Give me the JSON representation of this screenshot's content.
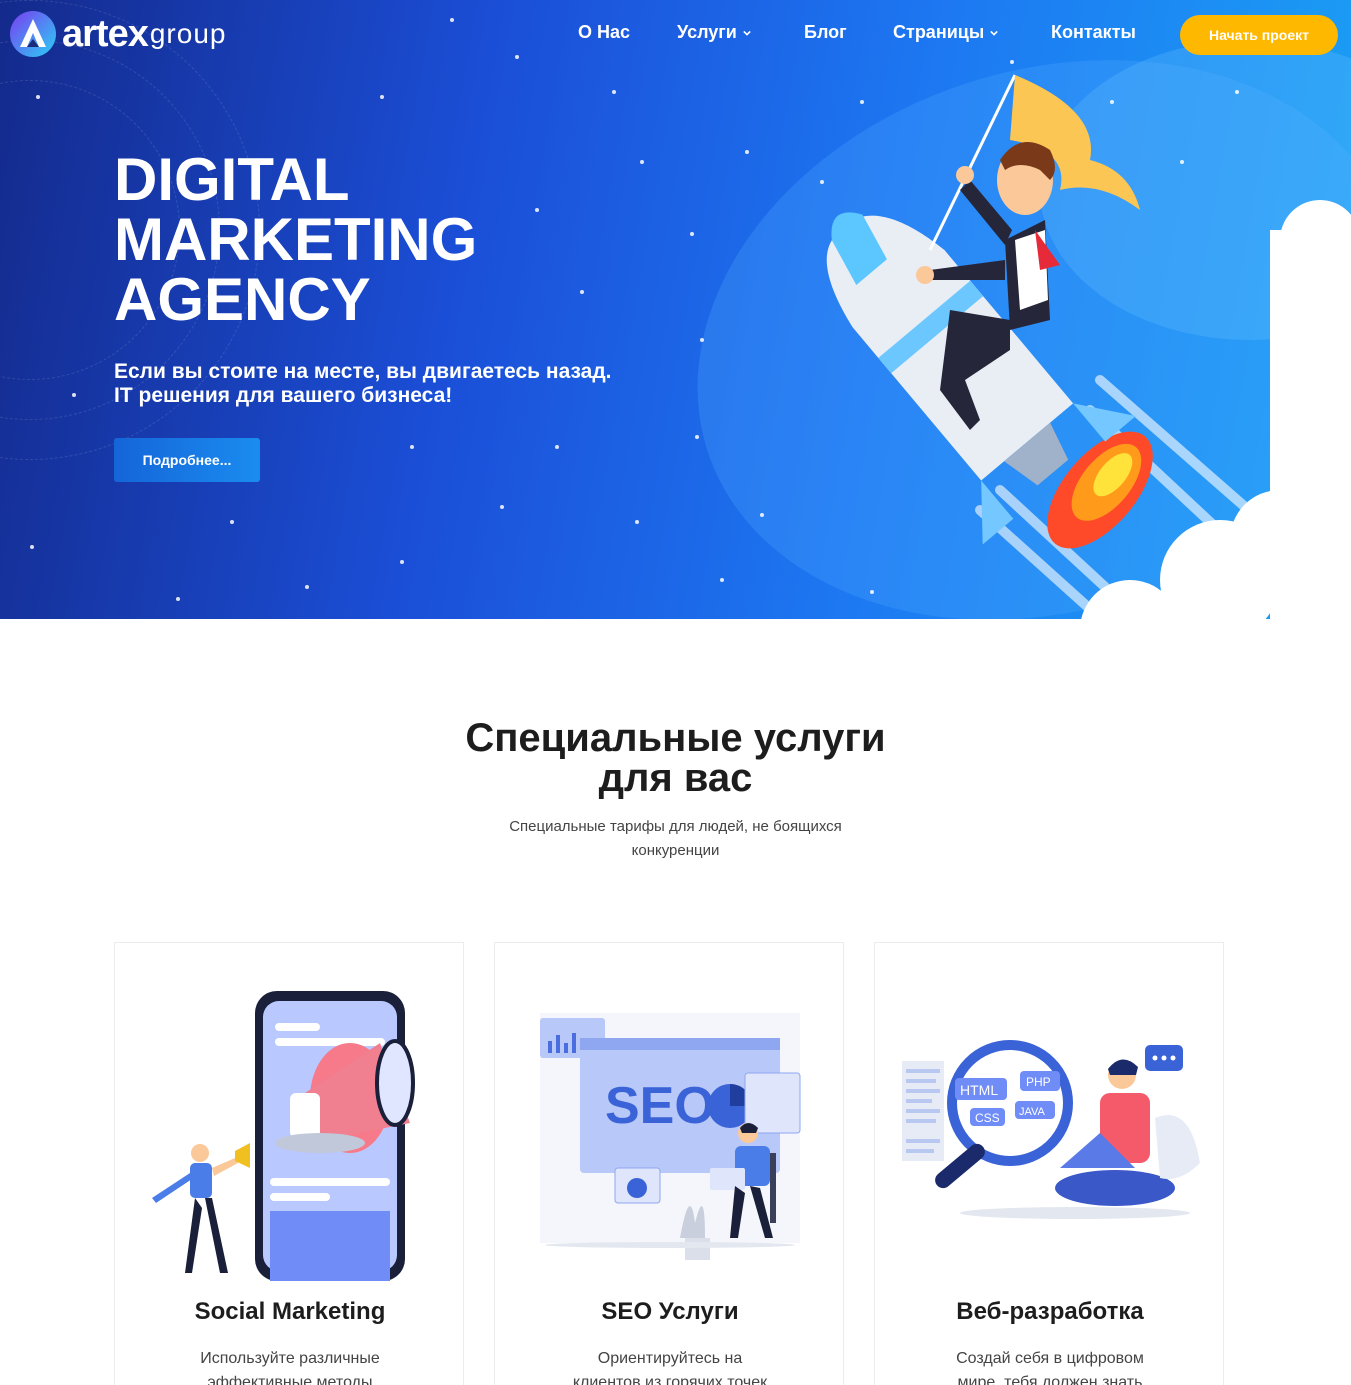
{
  "brand": {
    "name_main": "artex",
    "name_sub": "group"
  },
  "nav": {
    "items": [
      {
        "label": "О Нас",
        "has_dropdown": false
      },
      {
        "label": "Услуги",
        "has_dropdown": true
      },
      {
        "label": "Блог",
        "has_dropdown": false
      },
      {
        "label": "Страницы",
        "has_dropdown": true
      },
      {
        "label": "Контакты",
        "has_dropdown": false
      }
    ],
    "cta_label": "Начать проект"
  },
  "hero": {
    "title_lines": [
      "DIGITAL",
      "MARKETING",
      "AGENCY"
    ],
    "subtitle_lines": [
      "Если вы стоите на месте, вы двигаетесь назад.",
      "IT решения для вашего бизнеса!"
    ],
    "button_label": "Подробнее...",
    "illustration": "rocket-businessman-illustration"
  },
  "services": {
    "title_lines": [
      "Специальные услуги",
      "для вас"
    ],
    "subtitle_lines": [
      "Специальные тарифы для людей, не боящихся",
      "конкуренции"
    ],
    "cards": [
      {
        "title": "Social Marketing",
        "text_lines": [
          "Используйте различные",
          "эффективные методы"
        ],
        "illustration": "megaphone-phone-illustration"
      },
      {
        "title": "SEO Услуги",
        "text_lines": [
          "Ориентируйтесь на",
          "клиентов из горячих точек"
        ],
        "illustration": "seo-laptop-illustration"
      },
      {
        "title": "Веб-разработка",
        "text_lines": [
          "Создай себя в цифровом",
          "мире, тебя должен знать"
        ],
        "illustration": "web-dev-magnifier-illustration"
      }
    ]
  },
  "colors": {
    "hero_gradient_start": "#142a8c",
    "hero_gradient_end": "#1aa3f5",
    "cta": "#ffb800",
    "button_blue": "#1a8cf0",
    "heading": "#1d1d1d"
  }
}
